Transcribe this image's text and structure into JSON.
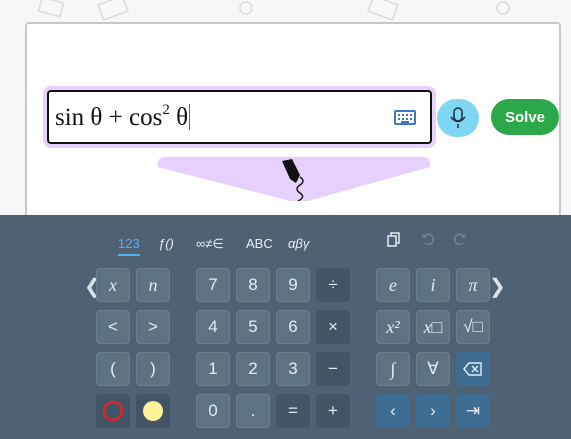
{
  "input": {
    "expression_main": "sin θ + cos",
    "expression_exp": "2",
    "expression_tail": " θ"
  },
  "actions": {
    "solve_label": "Solve"
  },
  "keyboard": {
    "tabs": [
      "123",
      "ƒ()",
      "∞≠∈",
      "ABC",
      "αβγ"
    ],
    "active_tab": "123",
    "left_group": [
      "x",
      "n",
      "<",
      ">",
      "(",
      ")"
    ],
    "numpad": [
      "7",
      "8",
      "9",
      "÷",
      "4",
      "5",
      "6",
      "×",
      "1",
      "2",
      "3",
      "−",
      "0",
      ".",
      "=",
      "+"
    ],
    "right_group": [
      "e",
      "i",
      "π",
      "x²",
      "x□",
      "√□",
      "∫",
      "∀",
      "⌫",
      "‹",
      "›",
      "⇥"
    ]
  },
  "colors": {
    "accent": "#2aa84a",
    "keyboard_bg": "#4e6273",
    "highlight": "#e5d1fb",
    "mic": "#7fd6f3"
  },
  "icons": [
    "keyboard-icon",
    "microphone-icon",
    "pen-icon",
    "copy-icon",
    "undo-icon",
    "redo-icon",
    "backspace-icon",
    "chevron-left-icon",
    "chevron-right-icon",
    "red-circle-icon",
    "yellow-dot-icon"
  ]
}
